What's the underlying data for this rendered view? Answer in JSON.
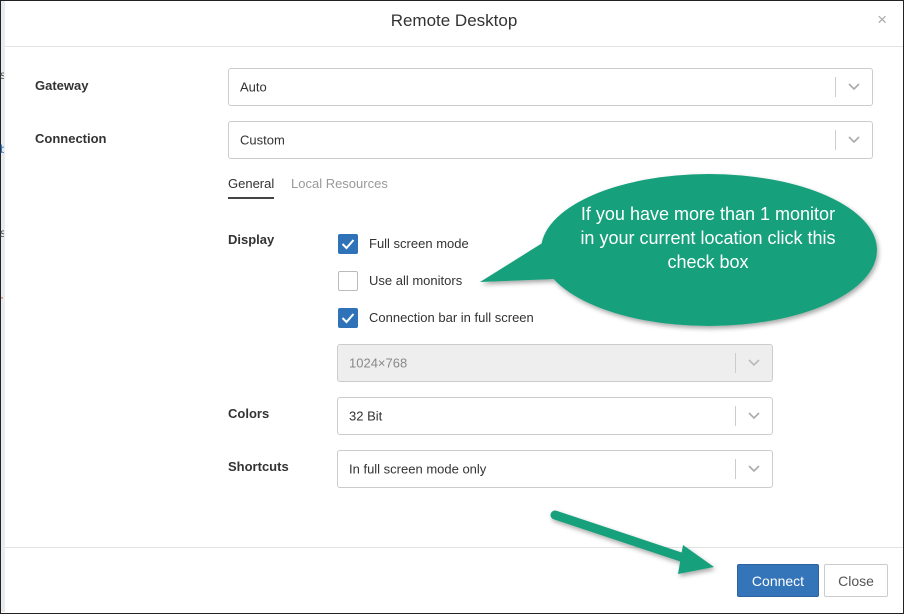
{
  "dialog": {
    "title": "Remote Desktop",
    "close_symbol": "×"
  },
  "form": {
    "gateway": {
      "label": "Gateway",
      "value": "Auto"
    },
    "connection": {
      "label": "Connection",
      "value": "Custom"
    }
  },
  "tabs": [
    {
      "label": "General",
      "active": true
    },
    {
      "label": "Local Resources",
      "active": false
    }
  ],
  "display": {
    "label": "Display",
    "options": [
      {
        "label": "Full screen mode",
        "checked": true
      },
      {
        "label": "Use all monitors",
        "checked": false
      },
      {
        "label": "Connection bar in full screen",
        "checked": true
      }
    ],
    "resolution": "1024×768"
  },
  "colors": {
    "label": "Colors",
    "value": "32 Bit"
  },
  "shortcuts": {
    "label": "Shortcuts",
    "value": "In full screen mode only"
  },
  "buttons": {
    "connect": "Connect",
    "close": "Close"
  },
  "callout": {
    "text": "If you have more than 1 monitor in your current location click this check box"
  },
  "theme": {
    "accent": "#3474b9",
    "checkbox": "#2f72b8",
    "callout": "#17a07c",
    "arrow": "#17a07c"
  },
  "icons": {
    "dropdown": "chevron-down-icon",
    "checkbox": "checkmark-icon",
    "close": "close-icon"
  }
}
